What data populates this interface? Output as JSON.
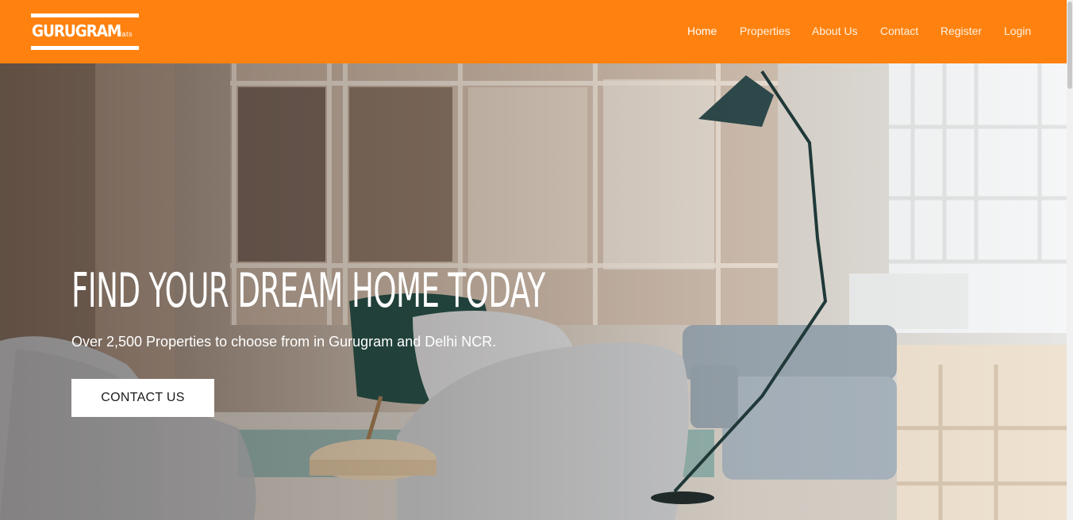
{
  "brand": {
    "name": "GURUGRAM",
    "suffix": "flats"
  },
  "nav": {
    "items": [
      {
        "label": "Home",
        "active": true
      },
      {
        "label": "Properties"
      },
      {
        "label": "About Us"
      },
      {
        "label": "Contact"
      },
      {
        "label": "Register"
      },
      {
        "label": "Login"
      }
    ]
  },
  "hero": {
    "title": "FIND YOUR DREAM HOME TODAY",
    "subtitle": "Over 2,500 Properties to choose from in Gurugram and Delhi NCR.",
    "cta_label": "CONTACT US"
  },
  "colors": {
    "header_bg": "#ff8210",
    "nav_text": "#fff2e2",
    "cta_bg": "#ffffff"
  }
}
